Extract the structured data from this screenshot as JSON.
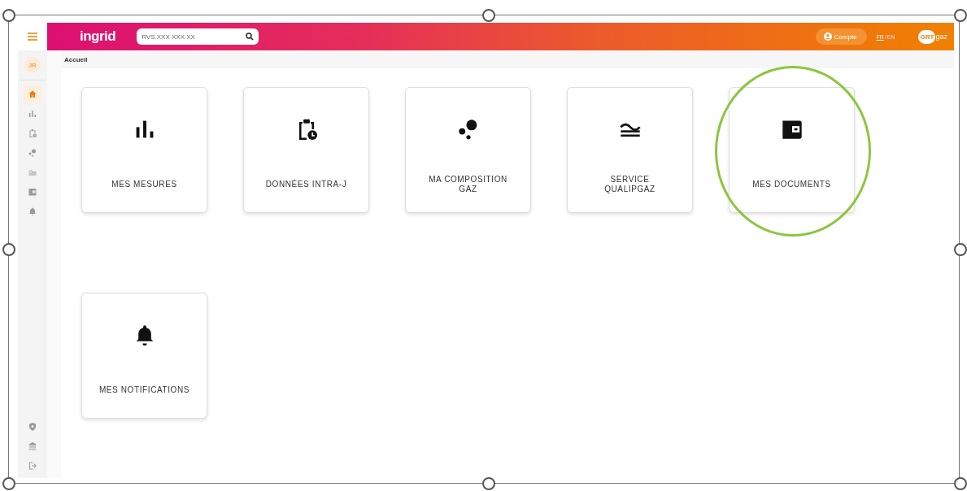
{
  "topbar": {
    "logo": "ingrid",
    "search": {
      "placeholder": "RVS.XXX XXX XX"
    },
    "account": "Compte",
    "languages": [
      {
        "label": "FR",
        "selected": true
      },
      {
        "label": "EN",
        "selected": false
      }
    ],
    "language_separator": "/",
    "brand": {
      "mark": "GRT",
      "text": "gaz"
    }
  },
  "sidebar": {
    "user": "JR",
    "items": [
      {
        "kind": "home",
        "selected": true
      },
      {
        "kind": "bars",
        "selected": false
      },
      {
        "kind": "clipboard",
        "selected": false
      },
      {
        "kind": "dots",
        "selected": false
      },
      {
        "kind": "waves",
        "selected": false
      },
      {
        "kind": "wallet",
        "selected": false
      },
      {
        "kind": "bell",
        "selected": false
      }
    ],
    "bottom_items": [
      {
        "kind": "shield"
      },
      {
        "kind": "bank"
      },
      {
        "kind": "logout"
      }
    ]
  },
  "breadcrumb": "Accueil",
  "tiles": [
    {
      "kind": "bars",
      "label": "MES MESURES"
    },
    {
      "kind": "clipboard",
      "label": "DONNÉES INTRA-J"
    },
    {
      "kind": "dots",
      "label": "MA COMPOSITION GAZ"
    },
    {
      "kind": "waves",
      "label": "SERVICE QUALIPGAZ"
    },
    {
      "kind": "wallet",
      "label": "MES DOCUMENTS"
    },
    {
      "kind": "bell",
      "label": "MES NOTIFICATIONS"
    }
  ]
}
